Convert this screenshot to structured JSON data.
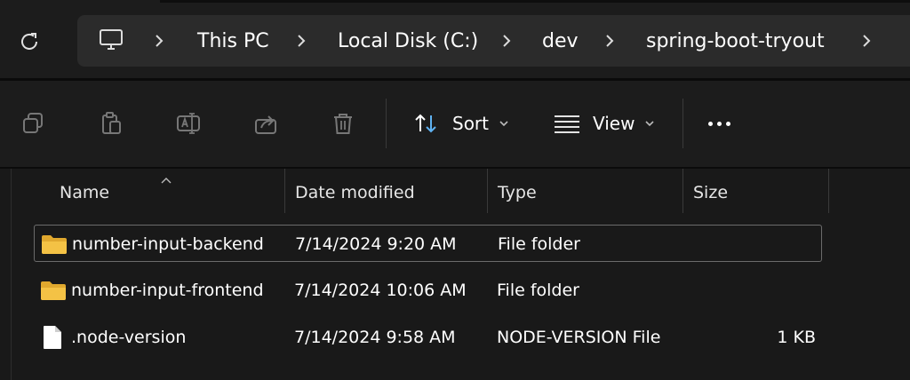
{
  "breadcrumb": {
    "items": [
      "This PC",
      "Local Disk (C:)",
      "dev",
      "spring-boot-tryout"
    ]
  },
  "toolbar": {
    "sort_label": "Sort",
    "view_label": "View"
  },
  "columns": {
    "name": "Name",
    "date": "Date modified",
    "type": "Type",
    "size": "Size"
  },
  "files": [
    {
      "name": "number-input-backend",
      "date": "7/14/2024 9:20 AM",
      "type": "File folder",
      "size": "",
      "icon": "folder-icon"
    },
    {
      "name": "number-input-frontend",
      "date": "7/14/2024 10:06 AM",
      "type": "File folder",
      "size": "",
      "icon": "folder-icon"
    },
    {
      "name": ".node-version",
      "date": "7/14/2024 9:58 AM",
      "type": "NODE-VERSION File",
      "size": "1 KB",
      "icon": "file-icon"
    }
  ],
  "colors": {
    "background": "#191919",
    "address_bar": "#2b2b2b",
    "folder": "#f4c245"
  }
}
